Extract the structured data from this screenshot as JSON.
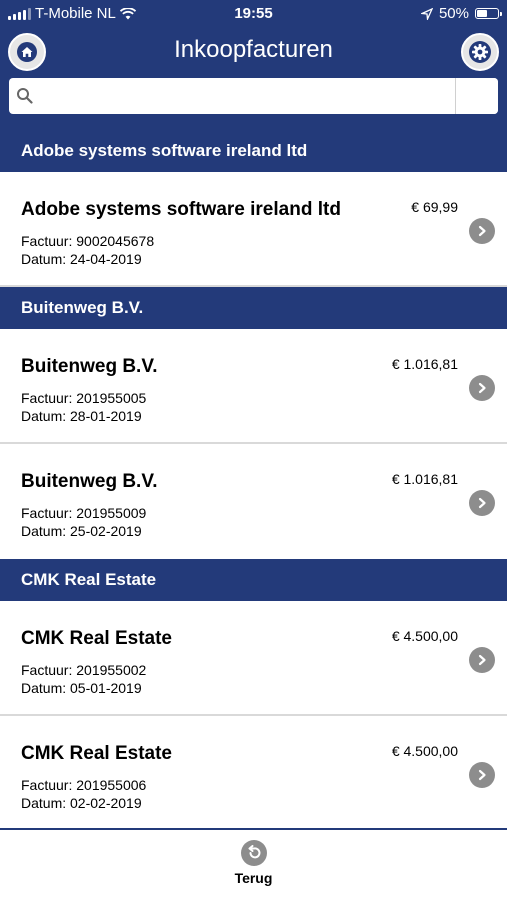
{
  "status": {
    "carrier": "T-Mobile NL",
    "time": "19:55",
    "battery": "50%",
    "battery_level": 0.5
  },
  "header": {
    "title": "Inkoopfacturen",
    "home_icon": "home-icon",
    "settings_icon": "gear-icon"
  },
  "search": {
    "placeholder": "",
    "value": "",
    "icon": "search-icon"
  },
  "groups": [
    {
      "header": "Adobe systems software ireland ltd",
      "items": [
        {
          "name": "Adobe systems software ireland ltd",
          "amount": "€ 69,99",
          "invoice": "Factuur: 9002045678",
          "date": "Datum: 24-04-2019"
        }
      ]
    },
    {
      "header": "Buitenweg B.V.",
      "items": [
        {
          "name": "Buitenweg B.V.",
          "amount": "€ 1.016,81",
          "invoice": "Factuur: 201955005",
          "date": "Datum: 28-01-2019"
        },
        {
          "name": "Buitenweg B.V.",
          "amount": "€ 1.016,81",
          "invoice": "Factuur: 201955009",
          "date": "Datum: 25-02-2019"
        }
      ]
    },
    {
      "header": "CMK Real Estate",
      "items": [
        {
          "name": "CMK Real Estate",
          "amount": "€ 4.500,00",
          "invoice": "Factuur: 201955002",
          "date": "Datum: 05-01-2019"
        },
        {
          "name": "CMK Real Estate",
          "amount": "€ 4.500,00",
          "invoice": "Factuur: 201955006",
          "date": "Datum: 02-02-2019"
        }
      ]
    }
  ],
  "footer": {
    "back_label": "Terug",
    "back_icon": "undo-icon"
  },
  "colors": {
    "navy": "#233a7a",
    "chevron_gray": "#8d8d8d"
  }
}
